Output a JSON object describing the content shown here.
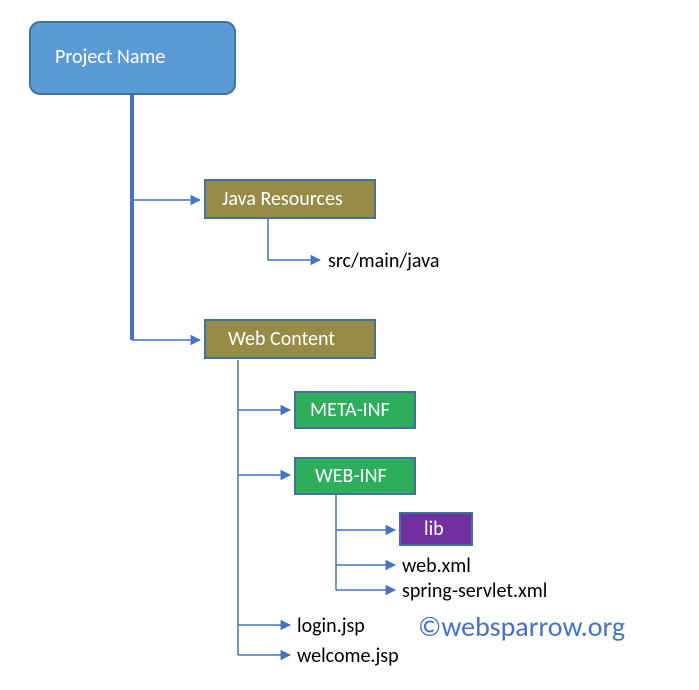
{
  "root": {
    "label": "Project Name"
  },
  "java_resources": {
    "label": "Java Resources"
  },
  "src_main_java": "src/main/java",
  "web_content": {
    "label": "Web Content"
  },
  "meta_inf": {
    "label": "META-INF"
  },
  "web_inf": {
    "label": "WEB-INF"
  },
  "lib": {
    "label": "lib"
  },
  "web_xml": "web.xml",
  "spring_servlet_xml": "spring-servlet.xml",
  "login_jsp": "login.jsp",
  "welcome_jsp": "welcome.jsp",
  "watermark": "©websparrow.org"
}
